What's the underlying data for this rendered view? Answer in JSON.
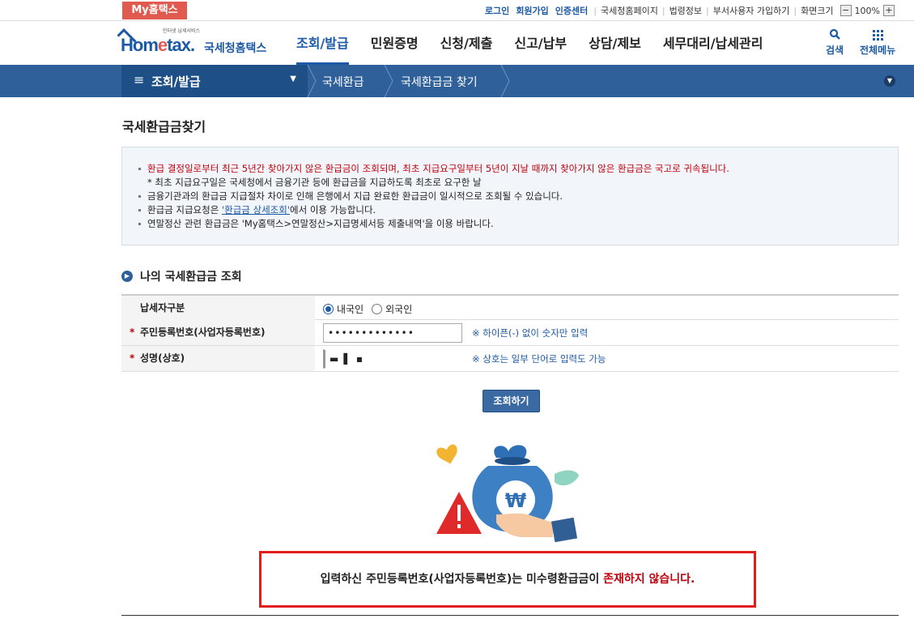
{
  "top": {
    "my_badge": "My홈택스",
    "login": "로그인",
    "join": "회원가입",
    "cert": "인증센터",
    "links": [
      "국세청홈페이지",
      "법령정보",
      "부서사용자 가입하기"
    ],
    "zoom_label": "화면크기",
    "zoom_minus": "−",
    "zoom_value": "100%",
    "zoom_plus": "+"
  },
  "logo": {
    "small": "인터넷 납세서비스",
    "home1": "Hom",
    "home2": "e",
    "home3": "tax.",
    "kr": "국세청홈택스"
  },
  "gnb": [
    "조회/발급",
    "민원증명",
    "신청/제출",
    "신고/납부",
    "상담/제보",
    "세무대리/납세관리"
  ],
  "header_icons": {
    "search": "검색",
    "all_menu": "전체메뉴"
  },
  "nav": {
    "menu_label": "조회/발급",
    "crumb1": "국세환급",
    "crumb2": "국세환급금 찾기"
  },
  "page_title": "국세환급금찾기",
  "info": {
    "l1": "환급 결정일로부터 최근 5년간 찾아가지 않은 환급금이 조회되며, 최초 지급요구일부터 5년이 지날 때까지 찾아가지 않은 환급금은 국고로 귀속됩니다.",
    "l2": "* 최초 지급요구일은 국세청에서 금융기관 등에 환급금을 지급하도록 최초로 요구한 날",
    "l3": "금융기관과의 환급금 지급절차 차이로 인해 은행에서 지급 완료한 환급금이 일시적으로 조회될 수 있습니다.",
    "l4_pre": "환급금 지급요청은 ",
    "l4_link": "'환급금 상세조회'",
    "l4_post": "에서 이용 가능합니다.",
    "l5": "연말정산 관련 환급금은 'My홈택스>연말정산>지급명세서등 제출내역'을 이용 바랍니다."
  },
  "section_title": "나의 국세환급금 조회",
  "form": {
    "type_label": "납세자구분",
    "domestic": "내국인",
    "foreign": "외국인",
    "id_label": "주민등록번호(사업자등록번호)",
    "id_value": "•••••••••••••",
    "id_hint": "※ 하이픈(-) 없이 숫자만 입력",
    "name_label": "성명(상호)",
    "name_value": "▬ ▌ ▪",
    "name_hint": "※ 상호는 일부 단어로 입력도 가능",
    "required_mark": "*"
  },
  "search_button": "조회하기",
  "result": {
    "pre": "입력하신 주민등록번호(사업자등록번호)는 미수령환급금이 ",
    "red": "존재하지 않습니다."
  },
  "colors": {
    "brand": "#1d5aa6",
    "nav": "#2f6099",
    "alert": "#e21d1d",
    "badge": "#e05a4f"
  }
}
